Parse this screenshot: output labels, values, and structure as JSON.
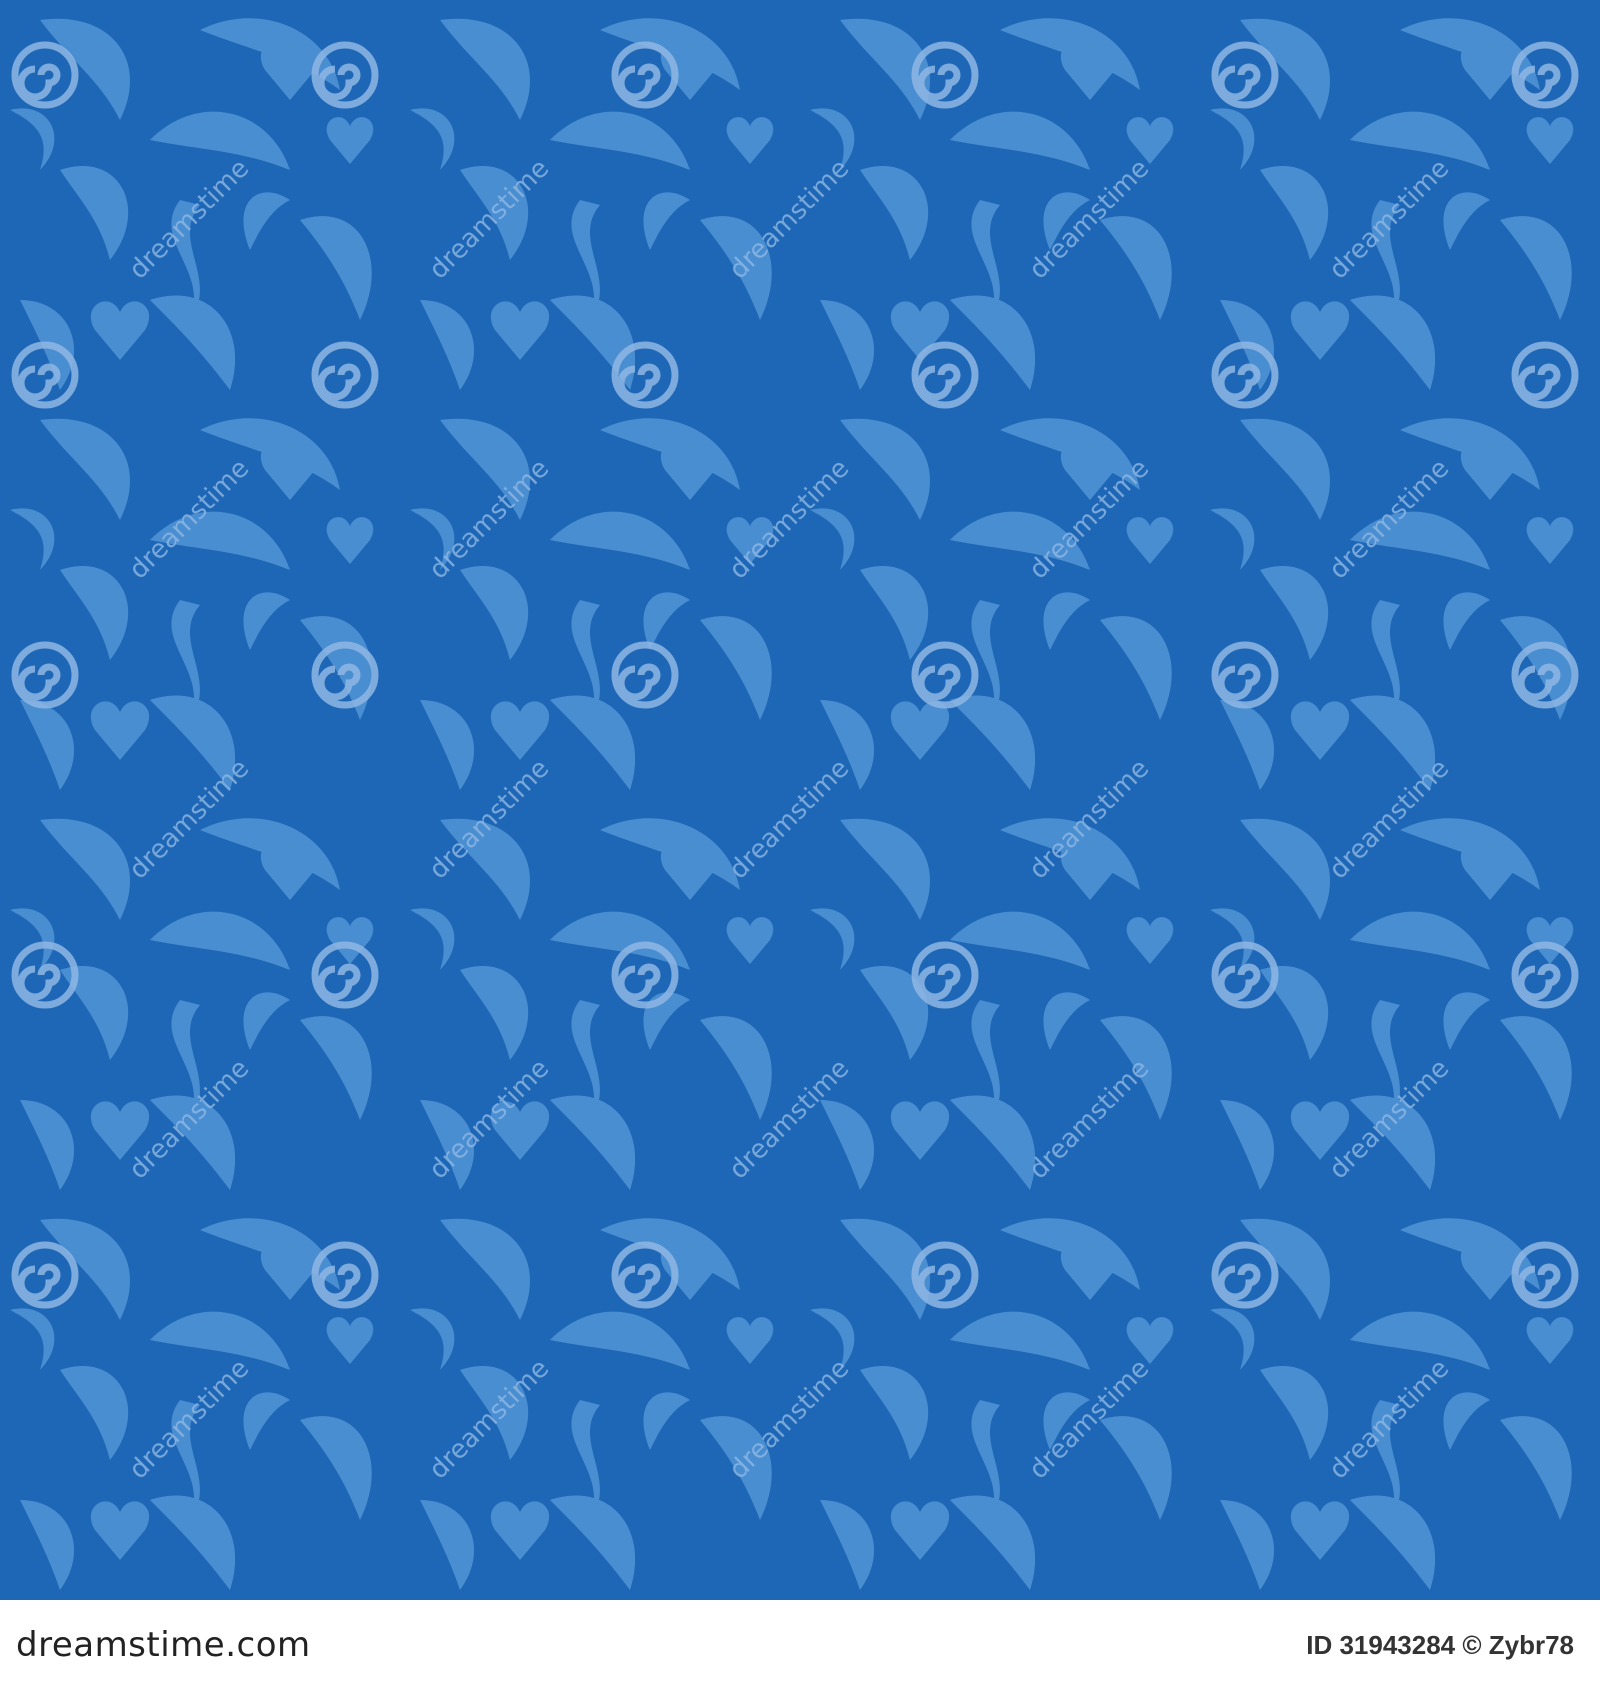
{
  "pattern": {
    "background_color": "#1e67b6",
    "motif_color": "#4a8ed2",
    "watermark_color": "#8fb8e4"
  },
  "watermark": {
    "text": "dreamstime",
    "icon": "spiral-logo-icon"
  },
  "footer": {
    "logo_text": "dreamstime.com",
    "image_id_label": "ID 31943284 © Zybr78"
  }
}
